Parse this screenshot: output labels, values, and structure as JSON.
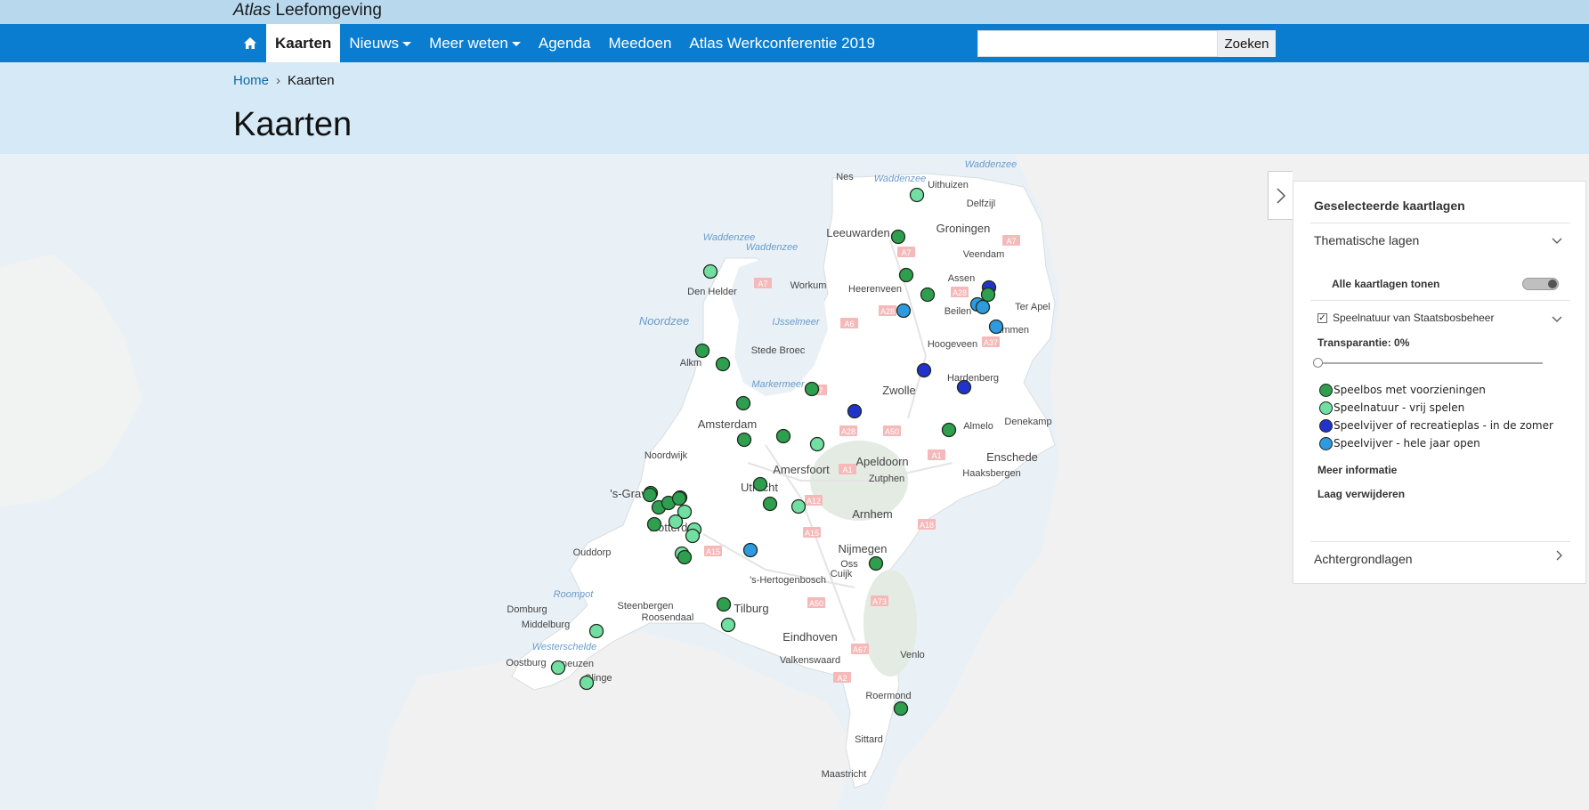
{
  "brand": {
    "italic": "Atlas",
    "rest": " Leefomgeving"
  },
  "nav": {
    "home_icon": "home-icon",
    "items": [
      {
        "label": "Kaarten",
        "active": true,
        "dropdown": false
      },
      {
        "label": "Nieuws",
        "active": false,
        "dropdown": true
      },
      {
        "label": "Meer weten",
        "active": false,
        "dropdown": true
      },
      {
        "label": "Agenda",
        "active": false,
        "dropdown": false
      },
      {
        "label": "Meedoen",
        "active": false,
        "dropdown": false
      },
      {
        "label": "Atlas Werkconferentie 2019",
        "active": false,
        "dropdown": false
      }
    ]
  },
  "search": {
    "value": "",
    "placeholder": "",
    "button": "Zoeken"
  },
  "breadcrumb": {
    "home": "Home",
    "separator": "›",
    "current": "Kaarten"
  },
  "page_title": "Kaarten",
  "colors": {
    "nav_blue": "#0a7dd0",
    "speelbos": "#2e9e4f",
    "speelnatuur": "#72dfa2",
    "speelvijver_zomer": "#2233cc",
    "speelvijver_jaar": "#2e9be0"
  },
  "panel": {
    "title": "Geselecteerde kaartlagen",
    "thematische": "Thematische lagen",
    "alle_tonen": "Alle kaartlagen tonen",
    "layer_name": "Speelnatuur van Staatsbosbeheer",
    "transparency_label": "Transparantie: 0%",
    "transparency_value": 0,
    "legend": [
      {
        "label": "Speelbos met voorzieningen",
        "color": "#2e9e4f"
      },
      {
        "label": "Speelnatuur - vrij spelen",
        "color": "#72dfa2"
      },
      {
        "label": "Speelvijver of recreatieplas - in de zomer",
        "color": "#2233cc"
      },
      {
        "label": "Speelvijver - hele jaar open",
        "color": "#2e9be0"
      }
    ],
    "meer_informatie": "Meer informatie",
    "laag_verwijderen": "Laag verwijderen",
    "achtergrond": "Achtergrondlagen"
  },
  "map_labels": {
    "places": [
      "Nes",
      "Uithuizen",
      "Delfzijl",
      "Leeuwarden",
      "Groningen",
      "Veendam",
      "Den Helder",
      "Workum",
      "Heerenveen",
      "Assen",
      "Beilen",
      "Ter Apel",
      "Emmen",
      "Stede Broec",
      "Hoogeveen",
      "Alkm",
      "Hardenberg",
      "Zwolle",
      "Amsterdam",
      "Almelo",
      "Denekamp",
      "Noordwijk",
      "Amersfoort",
      "Apeldoorn",
      "Enschede",
      "Zutphen",
      "Haaksbergen",
      "'s-Grav",
      "Utrecht",
      "Rotterd",
      "Arnhem",
      "Ouddorp",
      "Nijmegen",
      "Oss",
      "Cuijk",
      "'s-Hertogenbosch",
      "Steenbergen",
      "Roosendaal",
      "Tilburg",
      "Domburg",
      "Middelburg",
      "Eindhoven",
      "Oostburg",
      "neuzen",
      "Clinge",
      "Valkenswaard",
      "Venlo",
      "Roermond",
      "Sittard",
      "Maastricht"
    ],
    "water": [
      "Waddenzee",
      "Waddenzee",
      "Waddenzee",
      "Waddenzee",
      "Noordzee",
      "IJsselmeer",
      "Markermeer",
      "Roompot",
      "Westerschelde"
    ],
    "roads": [
      "A7",
      "A7",
      "A7",
      "A28",
      "A28",
      "A6",
      "A37",
      "A7",
      "A1",
      "A28",
      "A50",
      "A1",
      "A12",
      "A18",
      "A15",
      "A15",
      "A50",
      "A73",
      "A67",
      "A2"
    ]
  },
  "markers": [
    {
      "type": "speelnatuur"
    },
    {
      "type": "speelbos"
    },
    {
      "type": "speelbos"
    },
    {
      "type": "speelnatuur"
    },
    {
      "type": "speelbos"
    },
    {
      "type": "speelvijver_zomer"
    },
    {
      "type": "speelbos"
    },
    {
      "type": "speelvijver_jaar"
    },
    {
      "type": "speelvijver_jaar"
    },
    {
      "type": "speelvijver_jaar"
    },
    {
      "type": "speelvijver_jaar"
    },
    {
      "type": "speelbos"
    },
    {
      "type": "speelbos"
    },
    {
      "type": "speelvijver_zomer"
    },
    {
      "type": "speelvijver_zomer"
    },
    {
      "type": "speelbos"
    },
    {
      "type": "speelbos"
    },
    {
      "type": "speelbos"
    },
    {
      "type": "speelvijver_zomer"
    },
    {
      "type": "speelbos"
    },
    {
      "type": "speelbos"
    },
    {
      "type": "speelnatuur"
    },
    {
      "type": "speelbos"
    },
    {
      "type": "speelbos"
    },
    {
      "type": "speelbos"
    },
    {
      "type": "speelbos"
    },
    {
      "type": "speelbos"
    },
    {
      "type": "speelbos"
    },
    {
      "type": "speelnatuur"
    },
    {
      "type": "speelnatuur"
    },
    {
      "type": "speelbos"
    },
    {
      "type": "speelnatuur"
    },
    {
      "type": "speelnatuur"
    },
    {
      "type": "speelnatuur"
    },
    {
      "type": "speelbos"
    },
    {
      "type": "speelvijver_jaar"
    },
    {
      "type": "speelbos"
    },
    {
      "type": "speelnatuur"
    },
    {
      "type": "speelbos"
    },
    {
      "type": "speelbos"
    },
    {
      "type": "speelnatuur"
    },
    {
      "type": "speelnatuur"
    },
    {
      "type": "speelbos"
    },
    {
      "type": "speelnatuur"
    },
    {
      "type": "speelnatuur"
    },
    {
      "type": "speelbos"
    }
  ]
}
